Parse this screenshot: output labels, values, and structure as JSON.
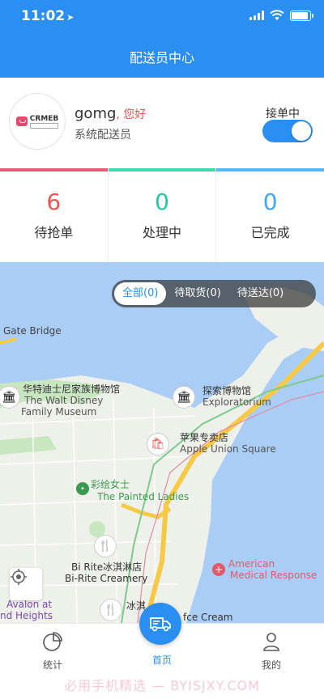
{
  "status_bar": {
    "time": "11:02",
    "location_arrow": "➤"
  },
  "header": {
    "title": "配送员中心"
  },
  "profile": {
    "avatar_logo": "CRMEB",
    "username": "gomg",
    "greeting": ", 您好",
    "role": "系统配送员",
    "accepting_label": "接单中",
    "accepting_on": true
  },
  "stats": [
    {
      "value": "6",
      "label": "待抢单",
      "color": "#ef5350",
      "bar_color": "#e85a78"
    },
    {
      "value": "0",
      "label": "处理中",
      "color": "#26c6a6",
      "bar_color": "#3ddbb0"
    },
    {
      "value": "0",
      "label": "已完成",
      "color": "#42a5f5",
      "bar_color": "#5ab4f5"
    }
  ],
  "filters": [
    {
      "label": "全部(0)",
      "active": true
    },
    {
      "label": "待取货(0)",
      "active": false
    },
    {
      "label": "待送达(0)",
      "active": false
    }
  ],
  "map_labels": {
    "gate_bridge": "Gate Bridge",
    "disney_cn": "华特迪士尼家族博物馆",
    "disney_en1": "The Walt Disney",
    "disney_en2": "Family Museum",
    "explor_cn": "探索博物馆",
    "explor_en": "Exploratorium",
    "apple_cn": "苹果专卖店",
    "apple_en": "Apple Union Square",
    "painted_cn": "彩绘女士",
    "painted_en": "The Painted Ladies",
    "birite_cn": "Bi Rite冰淇淋店",
    "birite_en": "Bi-Rite Creamery",
    "amr1": "American",
    "amr2": "Medical Response",
    "avalon1": "Avalon at",
    "avalon2": "nd Heights",
    "icecream_cn": "冰淇",
    "icecream_en": "fce Cream"
  },
  "tabbar": {
    "stats": "统计",
    "home": "首页",
    "mine": "我的"
  },
  "watermark": "必用手机精选 — BYISJXY.COM",
  "colors": {
    "primary": "#2a8ff0",
    "water": "#a9cdf5",
    "land": "#eef0ea",
    "park": "#c8e6c0",
    "highway": "#f7c948"
  }
}
